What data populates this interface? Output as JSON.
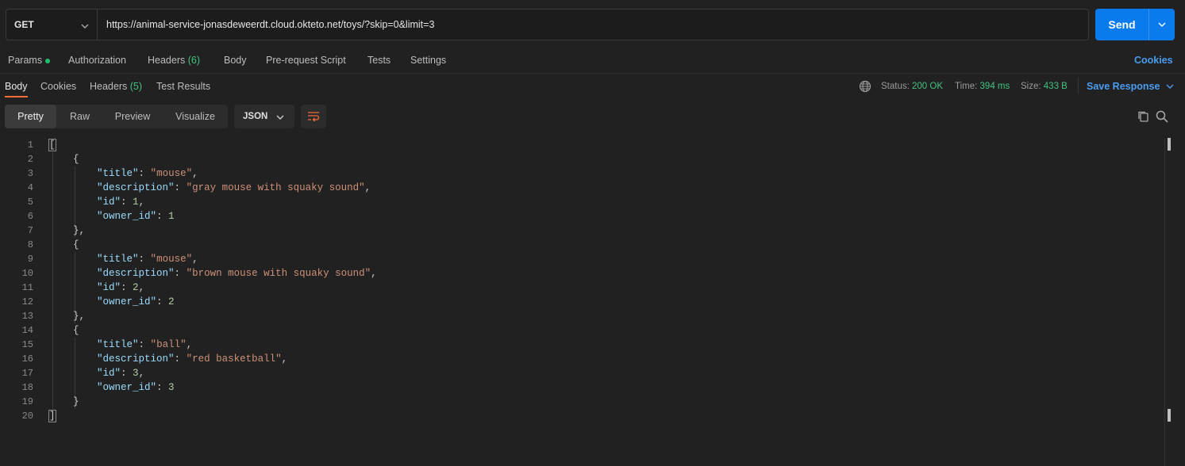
{
  "request": {
    "method": "GET",
    "url": "https://animal-service-jonasdeweerdt.cloud.okteto.net/toys/?skip=0&limit=3",
    "send_label": "Send"
  },
  "request_tabs": {
    "params": "Params",
    "authorization": "Authorization",
    "headers": "Headers",
    "headers_count": "(6)",
    "body": "Body",
    "prerequest": "Pre-request Script",
    "tests": "Tests",
    "settings": "Settings",
    "cookies": "Cookies"
  },
  "response_tabs": {
    "body": "Body",
    "cookies": "Cookies",
    "headers": "Headers",
    "headers_count": "(5)",
    "test_results": "Test Results"
  },
  "status": {
    "status_label": "Status:",
    "status_value": "200 OK",
    "time_label": "Time:",
    "time_value": "394 ms",
    "size_label": "Size:",
    "size_value": "433 B",
    "save_response": "Save Response"
  },
  "view": {
    "pretty": "Pretty",
    "raw": "Raw",
    "preview": "Preview",
    "visualize": "Visualize",
    "format": "JSON"
  },
  "response_body": [
    {
      "title": "mouse",
      "description": "gray mouse with squaky sound",
      "id": "1",
      "owner_id": "1"
    },
    {
      "title": "mouse",
      "description": "brown mouse with squaky sound",
      "id": "2",
      "owner_id": "2"
    },
    {
      "title": "ball",
      "description": "red basketball",
      "id": "3",
      "owner_id": "3"
    }
  ],
  "keys": {
    "title": "\"title\"",
    "description": "\"description\"",
    "id": "\"id\"",
    "owner_id": "\"owner_id\""
  },
  "line_numbers": [
    "1",
    "2",
    "3",
    "4",
    "5",
    "6",
    "7",
    "8",
    "9",
    "10",
    "11",
    "12",
    "13",
    "14",
    "15",
    "16",
    "17",
    "18",
    "19",
    "20"
  ],
  "colors": {
    "accent_blue": "#097bed",
    "status_green": "#42c380",
    "active_tab_underline": "#f26b3a"
  }
}
